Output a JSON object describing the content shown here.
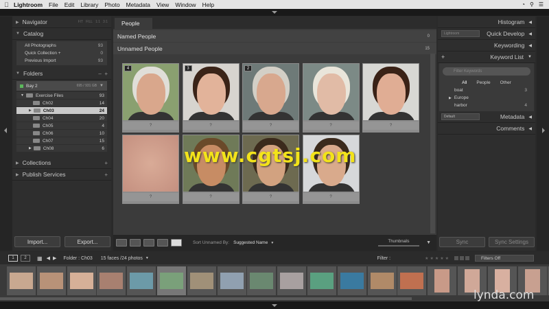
{
  "menubar": {
    "app_name": "Lightroom",
    "items": [
      "File",
      "Edit",
      "Library",
      "Photo",
      "Metadata",
      "View",
      "Window",
      "Help"
    ]
  },
  "left": {
    "navigator": {
      "title": "Navigator",
      "modes": [
        "FIT",
        "FILL",
        "1:1",
        "3:1"
      ]
    },
    "catalog": {
      "title": "Catalog",
      "items": [
        {
          "label": "All Photographs",
          "count": "93"
        },
        {
          "label": "Quick Collection +",
          "count": "0"
        },
        {
          "label": "Previous Import",
          "count": "93"
        }
      ]
    },
    "folders": {
      "title": "Folders",
      "drive": {
        "label": "Bay 2",
        "size": "695 / 931 GB"
      },
      "items": [
        {
          "label": "Exercise Files",
          "count": "93"
        },
        {
          "label": "Ch02",
          "count": "14"
        },
        {
          "label": "Ch03",
          "count": "24"
        },
        {
          "label": "Ch04",
          "count": "20"
        },
        {
          "label": "Ch05",
          "count": "4"
        },
        {
          "label": "Ch06",
          "count": "10"
        },
        {
          "label": "Ch07",
          "count": "15"
        },
        {
          "label": "Ch08",
          "count": "6"
        }
      ]
    },
    "collections": {
      "title": "Collections"
    },
    "publish": {
      "title": "Publish Services"
    },
    "import_label": "Import...",
    "export_label": "Export..."
  },
  "center": {
    "tab": "People",
    "named": {
      "title": "Named People",
      "count": "0"
    },
    "unnamed": {
      "title": "Unnamed People",
      "count": "15"
    },
    "faces": [
      {
        "badge": "4",
        "label": "?",
        "skin": "#d9a78c",
        "hair": "#e0ded8",
        "bg": "#8aa070"
      },
      {
        "badge": "3",
        "label": "?",
        "skin": "#e2b39a",
        "hair": "#3b2418",
        "bg": "#d7d4cf"
      },
      {
        "badge": "2",
        "label": "?",
        "skin": "#d8a88e",
        "hair": "#d3cfc6",
        "bg": "#6e7a78"
      },
      {
        "badge": "",
        "label": "?",
        "skin": "#e1bba6",
        "hair": "#e9e5da",
        "bg": "#7c8a86"
      },
      {
        "badge": "",
        "label": "?",
        "skin": "#e0ad94",
        "hair": "#3a2216",
        "bg": "#d8d8d4"
      },
      {
        "badge": "",
        "label": "?",
        "skin": "#d9ab97",
        "hair": "#d9ab97",
        "bg": "#d1a593"
      },
      {
        "badge": "",
        "label": "?",
        "skin": "#c78c64",
        "hair": "#6a4a2a",
        "bg": "#6f7a58"
      },
      {
        "badge": "",
        "label": "?",
        "skin": "#d2a280",
        "hair": "#3b2a1c",
        "bg": "#6d6a50"
      },
      {
        "badge": "",
        "label": "?",
        "skin": "#d9aa8c",
        "hair": "#3a2a1c",
        "bg": "#d6d8da"
      }
    ],
    "toolbar": {
      "sort_label": "Sort Unnamed By:",
      "sort_value": "Suggested Name",
      "thumb_label": "Thumbnails"
    }
  },
  "right": {
    "histogram": "Histogram",
    "quick_develop": "Quick Develop",
    "quick_develop_preset": "Lightroom",
    "keywording": "Keywording",
    "keyword_list": "Keyword List",
    "filter_placeholder": "Filter Keywords",
    "kw_tabs": [
      "All",
      "People",
      "Other"
    ],
    "keywords": [
      {
        "label": "boat",
        "count": "3"
      },
      {
        "label": "Europe",
        "count": ""
      },
      {
        "label": "harbor",
        "count": "4"
      }
    ],
    "metadata": "Metadata",
    "metadata_preset": "Default",
    "comments": "Comments",
    "sync": "Sync",
    "sync_settings": "Sync Settings"
  },
  "filmstrip": {
    "pages": [
      "1",
      "2"
    ],
    "folder": "Folder : Ch03",
    "info": "15 faces /24 photos",
    "filter_label": "Filter :",
    "filter_value": "Filters Off"
  },
  "watermark": "www.cgtsj.com",
  "brand": "lynda.com",
  "colors": {
    "accent": "#f3e31a",
    "selection": "#c9c9c9"
  }
}
